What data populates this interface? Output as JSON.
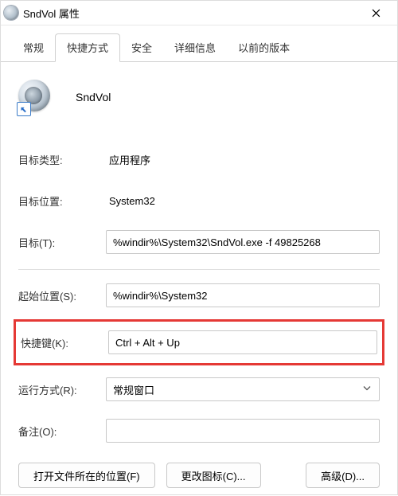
{
  "window": {
    "title": "SndVol 属性"
  },
  "tabs": [
    {
      "label": "常规"
    },
    {
      "label": "快捷方式"
    },
    {
      "label": "安全"
    },
    {
      "label": "详细信息"
    },
    {
      "label": "以前的版本"
    }
  ],
  "app": {
    "name": "SndVol"
  },
  "fields": {
    "target_type": {
      "label": "目标类型:",
      "value": "应用程序"
    },
    "target_location": {
      "label": "目标位置:",
      "value": "System32"
    },
    "target": {
      "label": "目标(T):",
      "value": "%windir%\\System32\\SndVol.exe -f 49825268"
    },
    "start_in": {
      "label": "起始位置(S):",
      "value": "%windir%\\System32"
    },
    "shortcut_key": {
      "label": "快捷键(K):",
      "value": "Ctrl + Alt + Up"
    },
    "run": {
      "label": "运行方式(R):",
      "value": "常规窗口"
    },
    "comment": {
      "label": "备注(O):",
      "value": ""
    }
  },
  "buttons": {
    "open_location": "打开文件所在的位置(F)",
    "change_icon": "更改图标(C)...",
    "advanced": "高级(D)..."
  }
}
